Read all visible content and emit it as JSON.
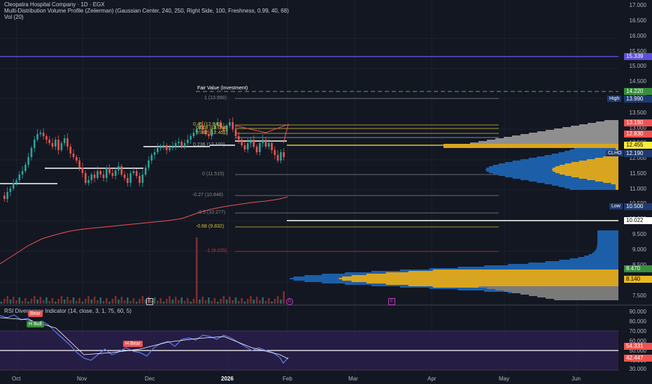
{
  "header": {
    "title": "Cleopatra Hospital Company · 1D · EGX",
    "indicator": "Multi-Distribution Volume Profile (Zeiierman) (Gaussian Center, 240, 250, Right Side, 100, Freshness, 0.99, 40, 68)",
    "volume": "Vol (20)"
  },
  "rsi_header": "RSI Divergence Indicator (14, close, 3, 1, 75, 60, 5)",
  "price_axis": [
    "17.000",
    "16.500",
    "16.000",
    "15.500",
    "15.000",
    "14.500",
    "14.000",
    "13.500",
    "13.000",
    "12.500",
    "12.000",
    "11.500",
    "11.000",
    "10.500",
    "10.000",
    "9.500",
    "9.000",
    "8.500",
    "8.000",
    "7.500"
  ],
  "rsi_axis": [
    "90.000",
    "80.000",
    "70.000",
    "60.000",
    "50.000",
    "40.000",
    "30.000"
  ],
  "date_axis": [
    "Oct",
    "Nov",
    "Dec",
    "2026",
    "Feb",
    "Mar",
    "Apr",
    "May",
    "Jun"
  ],
  "price_tags": {
    "p15339": "15.339",
    "p14220": "14.220",
    "p13990": "13.990",
    "p13190": "13.190",
    "p12830": "12.830",
    "p12455": "12.455",
    "p12190": "12.190",
    "p10500": "10.500",
    "p10022": "10.022",
    "p8470": "8.470",
    "p8140": "8.140",
    "r54331": "54.331",
    "r42447": "42.447"
  },
  "tag_labels": {
    "high": "High",
    "clho": "CLHO",
    "low": "Low"
  },
  "fair_value": "Fair Value (Investment)",
  "fib": {
    "f1": "1 (13.990)",
    "f0": "0 (11.515)",
    "fm027": "-0.27 (10.846)",
    "fm05": "-0.5 (10.277)",
    "fm068": "-0.68 (9.832)",
    "fm1": "-1 (9.035)",
    "f045": "0.45 (12.640)",
    "f0382": "0.382 (12.461)",
    "f0618": "0.618 (13.044)",
    "f0236": "0.236 (12.100)"
  },
  "signals": {
    "bear": "Bear",
    "hbull": "H Bull",
    "hbear": "H Bear"
  },
  "markers": {
    "e1": "E",
    "e2": "E",
    "d1": "D"
  },
  "colors": {
    "bg": "#131722",
    "up": "#26a69a",
    "down": "#ef5350",
    "purple_line": "#5b4fd6",
    "gold": "#e8b923",
    "blue_profile": "#1c5fa8",
    "gray_profile": "#9e9e9e",
    "rsi_band": "#2a1f4a",
    "rsi_line": "#5b7cfa"
  }
}
